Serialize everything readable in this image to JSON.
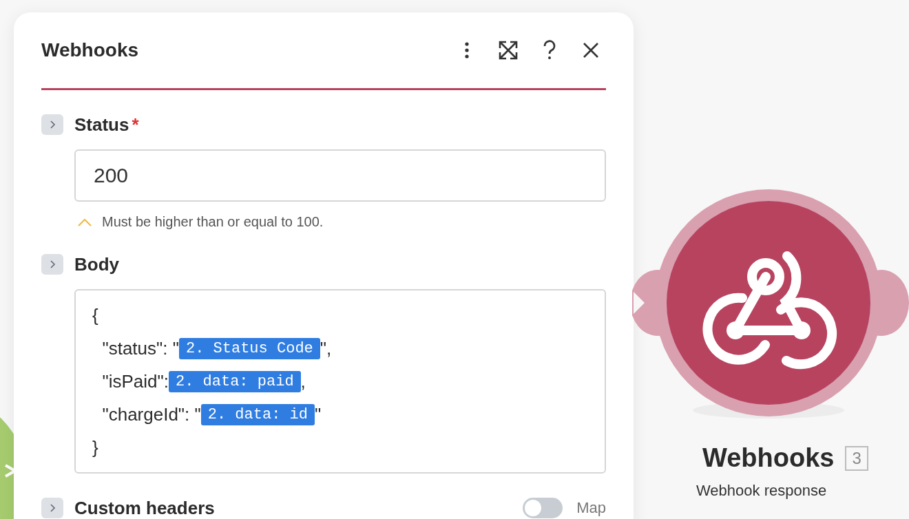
{
  "panel": {
    "title": "Webhooks",
    "fields": [
      {
        "kind": "input",
        "label": "Status",
        "required_mark": "*",
        "value": "200",
        "hint": "Must be higher than or equal to 100."
      },
      {
        "kind": "code",
        "label": "Body",
        "lines": [
          [
            {
              "kind": "text",
              "s": "{"
            }
          ],
          [
            {
              "kind": "text",
              "s": "  \"status\": \""
            },
            {
              "kind": "token",
              "s": "2. Status Code"
            },
            {
              "kind": "text",
              "s": "\","
            }
          ],
          [
            {
              "kind": "text",
              "s": "  \"isPaid\":"
            },
            {
              "kind": "token",
              "s": "2. data: paid"
            },
            {
              "kind": "text",
              "s": ","
            }
          ],
          [
            {
              "kind": "text",
              "s": "  \"chargeId\": \""
            },
            {
              "kind": "token",
              "s": "2. data: id"
            },
            {
              "kind": "text",
              "s": "\""
            }
          ],
          [
            {
              "kind": "text",
              "s": "}"
            }
          ]
        ]
      },
      {
        "kind": "toggle",
        "label": "Custom headers",
        "on": false,
        "toggle_label": "Map"
      }
    ]
  },
  "node": {
    "title": "Webhooks",
    "badge": "3",
    "subtitle": "Webhook response"
  }
}
